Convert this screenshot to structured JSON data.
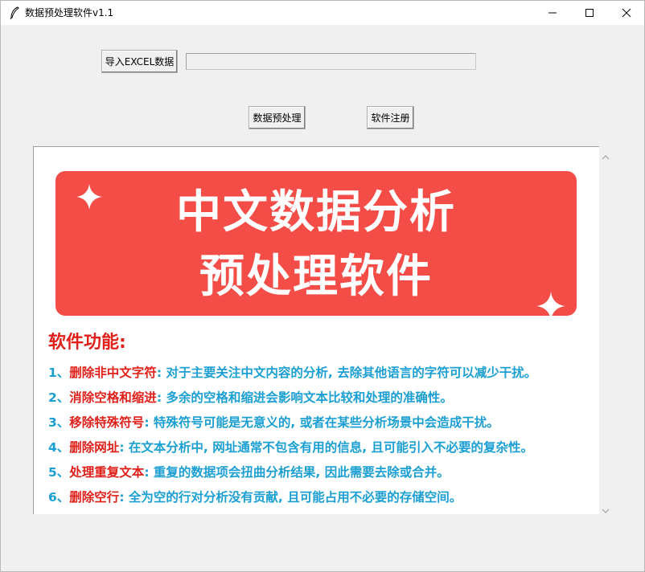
{
  "window": {
    "title": "数据预处理软件v1.1"
  },
  "toolbar": {
    "import_label": "导入EXCEL数据",
    "file_path_value": "",
    "preprocess_label": "数据预处理",
    "register_label": "软件注册"
  },
  "banner": {
    "line1": "中文数据分析",
    "line2": "预处理软件",
    "background": "#f44c47"
  },
  "features": {
    "title": "软件功能:",
    "items": [
      {
        "num": "1、",
        "key": "删除非中文字符",
        "desc": ": 对于主要关注中文内容的分析, 去除其他语言的字符可以减少干扰。"
      },
      {
        "num": "2、",
        "key": "消除空格和缩进",
        "desc": ": 多余的空格和缩进会影响文本比较和处理的准确性。"
      },
      {
        "num": "3、",
        "key": "移除特殊符号",
        "desc": ": 特殊符号可能是无意义的, 或者在某些分析场景中会造成干扰。"
      },
      {
        "num": "4、",
        "key": "删除网址",
        "desc": ": 在文本分析中, 网址通常不包含有用的信息, 且可能引入不必要的复杂性。"
      },
      {
        "num": "5、",
        "key": "处理重复文本",
        "desc": ": 重复的数据项会扭曲分析结果, 因此需要去除或合并。"
      },
      {
        "num": "6、",
        "key": "删除空行",
        "desc": ": 全为空的行对分析没有贡献, 且可能占用不必要的存储空间。"
      }
    ]
  },
  "colors": {
    "accent_red": "#e0201a",
    "accent_blue": "#1b9fd3"
  },
  "icons": {
    "app": "feather-icon",
    "minimize": "minimize-icon",
    "maximize": "maximize-icon",
    "close": "close-icon"
  }
}
